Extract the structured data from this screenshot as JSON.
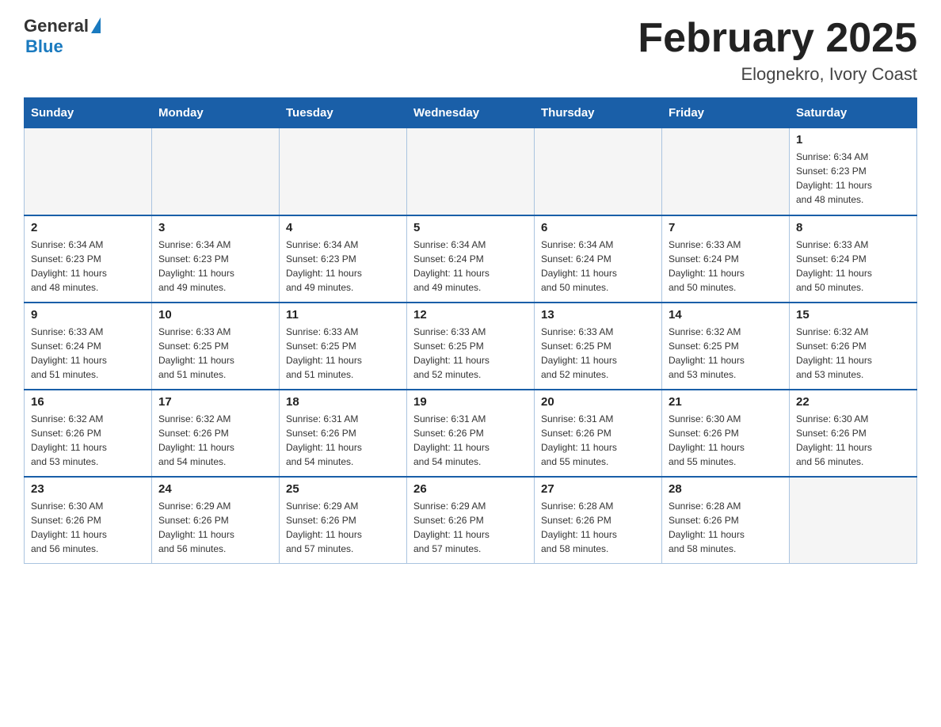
{
  "logo": {
    "general": "General",
    "blue": "Blue"
  },
  "title": "February 2025",
  "location": "Elognekro, Ivory Coast",
  "days_of_week": [
    "Sunday",
    "Monday",
    "Tuesday",
    "Wednesday",
    "Thursday",
    "Friday",
    "Saturday"
  ],
  "weeks": [
    [
      {
        "day": "",
        "info": "",
        "empty": true
      },
      {
        "day": "",
        "info": "",
        "empty": true
      },
      {
        "day": "",
        "info": "",
        "empty": true
      },
      {
        "day": "",
        "info": "",
        "empty": true
      },
      {
        "day": "",
        "info": "",
        "empty": true
      },
      {
        "day": "",
        "info": "",
        "empty": true
      },
      {
        "day": "1",
        "info": "Sunrise: 6:34 AM\nSunset: 6:23 PM\nDaylight: 11 hours\nand 48 minutes.",
        "empty": false
      }
    ],
    [
      {
        "day": "2",
        "info": "Sunrise: 6:34 AM\nSunset: 6:23 PM\nDaylight: 11 hours\nand 48 minutes.",
        "empty": false
      },
      {
        "day": "3",
        "info": "Sunrise: 6:34 AM\nSunset: 6:23 PM\nDaylight: 11 hours\nand 49 minutes.",
        "empty": false
      },
      {
        "day": "4",
        "info": "Sunrise: 6:34 AM\nSunset: 6:23 PM\nDaylight: 11 hours\nand 49 minutes.",
        "empty": false
      },
      {
        "day": "5",
        "info": "Sunrise: 6:34 AM\nSunset: 6:24 PM\nDaylight: 11 hours\nand 49 minutes.",
        "empty": false
      },
      {
        "day": "6",
        "info": "Sunrise: 6:34 AM\nSunset: 6:24 PM\nDaylight: 11 hours\nand 50 minutes.",
        "empty": false
      },
      {
        "day": "7",
        "info": "Sunrise: 6:33 AM\nSunset: 6:24 PM\nDaylight: 11 hours\nand 50 minutes.",
        "empty": false
      },
      {
        "day": "8",
        "info": "Sunrise: 6:33 AM\nSunset: 6:24 PM\nDaylight: 11 hours\nand 50 minutes.",
        "empty": false
      }
    ],
    [
      {
        "day": "9",
        "info": "Sunrise: 6:33 AM\nSunset: 6:24 PM\nDaylight: 11 hours\nand 51 minutes.",
        "empty": false
      },
      {
        "day": "10",
        "info": "Sunrise: 6:33 AM\nSunset: 6:25 PM\nDaylight: 11 hours\nand 51 minutes.",
        "empty": false
      },
      {
        "day": "11",
        "info": "Sunrise: 6:33 AM\nSunset: 6:25 PM\nDaylight: 11 hours\nand 51 minutes.",
        "empty": false
      },
      {
        "day": "12",
        "info": "Sunrise: 6:33 AM\nSunset: 6:25 PM\nDaylight: 11 hours\nand 52 minutes.",
        "empty": false
      },
      {
        "day": "13",
        "info": "Sunrise: 6:33 AM\nSunset: 6:25 PM\nDaylight: 11 hours\nand 52 minutes.",
        "empty": false
      },
      {
        "day": "14",
        "info": "Sunrise: 6:32 AM\nSunset: 6:25 PM\nDaylight: 11 hours\nand 53 minutes.",
        "empty": false
      },
      {
        "day": "15",
        "info": "Sunrise: 6:32 AM\nSunset: 6:26 PM\nDaylight: 11 hours\nand 53 minutes.",
        "empty": false
      }
    ],
    [
      {
        "day": "16",
        "info": "Sunrise: 6:32 AM\nSunset: 6:26 PM\nDaylight: 11 hours\nand 53 minutes.",
        "empty": false
      },
      {
        "day": "17",
        "info": "Sunrise: 6:32 AM\nSunset: 6:26 PM\nDaylight: 11 hours\nand 54 minutes.",
        "empty": false
      },
      {
        "day": "18",
        "info": "Sunrise: 6:31 AM\nSunset: 6:26 PM\nDaylight: 11 hours\nand 54 minutes.",
        "empty": false
      },
      {
        "day": "19",
        "info": "Sunrise: 6:31 AM\nSunset: 6:26 PM\nDaylight: 11 hours\nand 54 minutes.",
        "empty": false
      },
      {
        "day": "20",
        "info": "Sunrise: 6:31 AM\nSunset: 6:26 PM\nDaylight: 11 hours\nand 55 minutes.",
        "empty": false
      },
      {
        "day": "21",
        "info": "Sunrise: 6:30 AM\nSunset: 6:26 PM\nDaylight: 11 hours\nand 55 minutes.",
        "empty": false
      },
      {
        "day": "22",
        "info": "Sunrise: 6:30 AM\nSunset: 6:26 PM\nDaylight: 11 hours\nand 56 minutes.",
        "empty": false
      }
    ],
    [
      {
        "day": "23",
        "info": "Sunrise: 6:30 AM\nSunset: 6:26 PM\nDaylight: 11 hours\nand 56 minutes.",
        "empty": false
      },
      {
        "day": "24",
        "info": "Sunrise: 6:29 AM\nSunset: 6:26 PM\nDaylight: 11 hours\nand 56 minutes.",
        "empty": false
      },
      {
        "day": "25",
        "info": "Sunrise: 6:29 AM\nSunset: 6:26 PM\nDaylight: 11 hours\nand 57 minutes.",
        "empty": false
      },
      {
        "day": "26",
        "info": "Sunrise: 6:29 AM\nSunset: 6:26 PM\nDaylight: 11 hours\nand 57 minutes.",
        "empty": false
      },
      {
        "day": "27",
        "info": "Sunrise: 6:28 AM\nSunset: 6:26 PM\nDaylight: 11 hours\nand 58 minutes.",
        "empty": false
      },
      {
        "day": "28",
        "info": "Sunrise: 6:28 AM\nSunset: 6:26 PM\nDaylight: 11 hours\nand 58 minutes.",
        "empty": false
      },
      {
        "day": "",
        "info": "",
        "empty": true
      }
    ]
  ]
}
